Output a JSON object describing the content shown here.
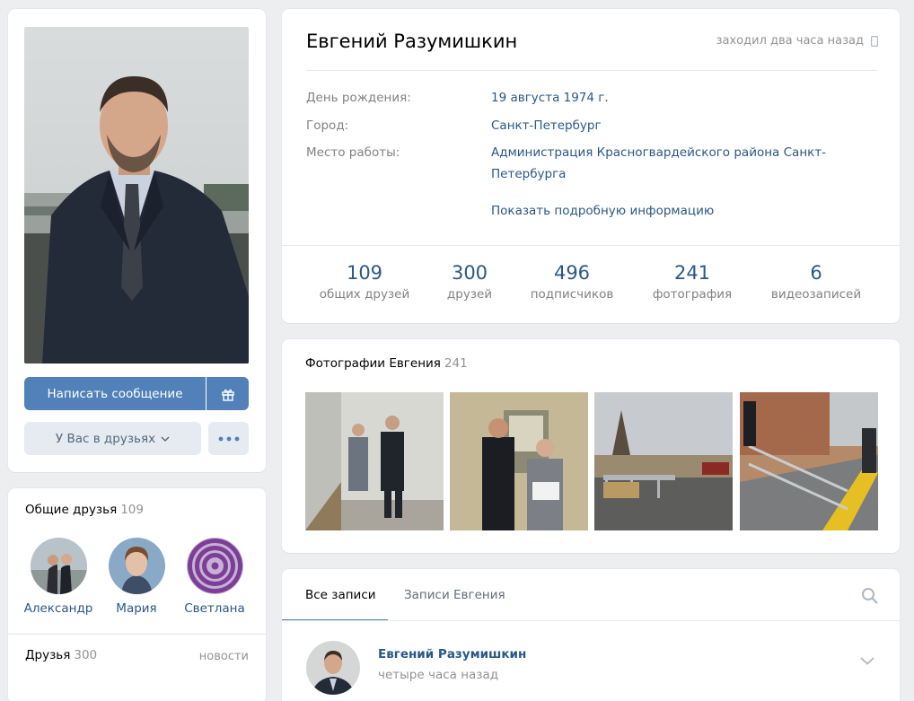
{
  "profile": {
    "name": "Евгений Разумишкин",
    "last_seen": "заходил два часа назад",
    "birthday_label": "День рождения:",
    "birthday": "19 августа 1974 г.",
    "city_label": "Город:",
    "city": "Санкт-Петербург",
    "work_label": "Место работы:",
    "work": "Администрация Красногвардейского района Санкт-Петербурга",
    "show_more": "Показать подробную информацию"
  },
  "counters": [
    {
      "num": "109",
      "label": "общих друзей"
    },
    {
      "num": "300",
      "label": "друзей"
    },
    {
      "num": "496",
      "label": "подписчиков"
    },
    {
      "num": "241",
      "label": "фотография"
    },
    {
      "num": "6",
      "label": "видеозаписей"
    }
  ],
  "actions": {
    "message": "Написать сообщение",
    "friends": "У Вас в друзьях"
  },
  "mutual_friends": {
    "title": "Общие друзья",
    "count": "109",
    "items": [
      {
        "name": "Александр"
      },
      {
        "name": "Мария"
      },
      {
        "name": "Светлана"
      }
    ]
  },
  "friends": {
    "title": "Друзья",
    "count": "300",
    "news": "новости"
  },
  "photos": {
    "title": "Фотографии Евгения",
    "count": "241"
  },
  "wall": {
    "tab_all": "Все записи",
    "tab_own": "Записи Евгения",
    "post_author": "Евгений Разумишкин",
    "post_time": "четыре часа назад"
  },
  "colors": {
    "accent": "#5181b8",
    "link": "#2a5885",
    "muted": "#828282",
    "background": "#edeef0"
  }
}
